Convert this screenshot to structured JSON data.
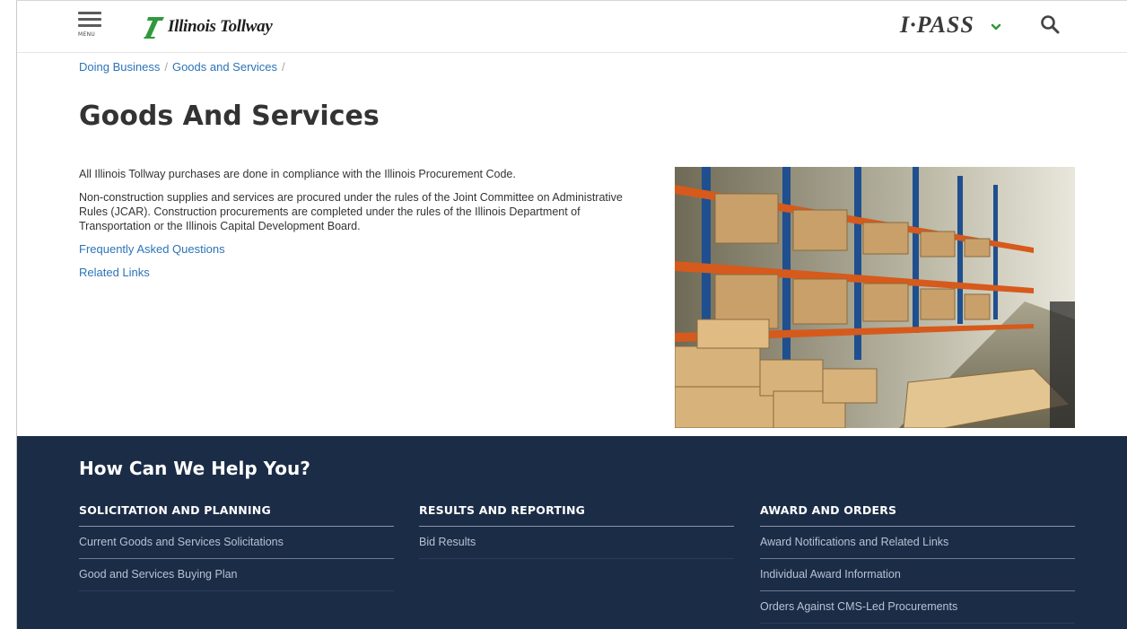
{
  "header": {
    "menu_label": "MENU",
    "logo_text": "Illinois Tollway",
    "ipass_label": "I·PASS",
    "brand_green": "#2f9a3c",
    "icons": [
      "hamburger-menu-icon",
      "tollway-logo-icon",
      "chevron-down-icon",
      "search-icon"
    ]
  },
  "breadcrumb": {
    "items": [
      "Doing Business",
      "Goods and Services"
    ],
    "separator": "/"
  },
  "page": {
    "title": "Goods And Services",
    "paragraphs": [
      "All Illinois Tollway purchases are done in compliance with the Illinois Procurement Code.",
      "Non-construction supplies and services are procured under the rules of the Joint Committee on Administrative Rules (JCAR). Construction procurements are completed under the rules of the Illinois Department of Transportation or the Illinois Capital Development Board."
    ],
    "links": [
      "Frequently Asked Questions",
      "Related Links"
    ]
  },
  "help": {
    "title": "How Can We Help You?",
    "background": "#1b2c46",
    "columns": [
      {
        "heading": "SOLICITATION AND PLANNING",
        "links": [
          "Current Goods and Services Solicitations",
          "Good and Services Buying Plan"
        ]
      },
      {
        "heading": "RESULTS AND REPORTING",
        "links": [
          "Bid Results"
        ]
      },
      {
        "heading": "AWARD AND ORDERS",
        "links": [
          "Award Notifications and Related Links",
          "Individual Award Information",
          "Orders Against CMS-Led Procurements"
        ]
      }
    ]
  }
}
